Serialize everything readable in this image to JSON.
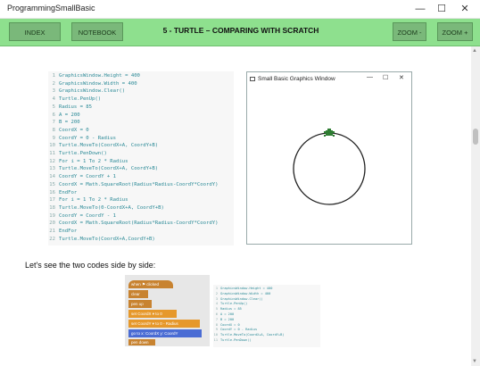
{
  "window": {
    "title": "ProgrammingSmallBasic",
    "minimize": "—",
    "maximize": "☐",
    "close": "✕"
  },
  "toolbar": {
    "index_label": "INDEX",
    "notebook_label": "NOTEBOOK",
    "page_title": "5 - TURTLE – COMPARING WITH SCRATCH",
    "zoom_out_label": "ZOOM -",
    "zoom_in_label": "ZOOM +"
  },
  "code": [
    {
      "n": "1",
      "t": "GraphicsWindow.Height = 400"
    },
    {
      "n": "2",
      "t": "GraphicsWindow.Width = 400"
    },
    {
      "n": "3",
      "t": "GraphicsWindow.Clear()"
    },
    {
      "n": "4",
      "t": "Turtle.PenUp()"
    },
    {
      "n": "5",
      "t": "Radius = 85"
    },
    {
      "n": "6",
      "t": "A = 200"
    },
    {
      "n": "7",
      "t": "B = 200"
    },
    {
      "n": "8",
      "t": "CoordX = 0"
    },
    {
      "n": "9",
      "t": "CoordY = 0 - Radius"
    },
    {
      "n": "10",
      "t": "Turtle.MoveTo(CoordX+A, CoordY+B)"
    },
    {
      "n": "11",
      "t": "Turtle.PenDown()"
    },
    {
      "n": "12",
      "t": "For i = 1 To 2 * Radius"
    },
    {
      "n": "13",
      "t": "  Turtle.MoveTo(CoordX+A, CoordY+B)"
    },
    {
      "n": "14",
      "t": "  CoordY = CoordY + 1"
    },
    {
      "n": "15",
      "t": "  CoordX = Math.SquareRoot(Radius*Radius-CoordY*CoordY)"
    },
    {
      "n": "16",
      "t": "EndFor"
    },
    {
      "n": "17",
      "t": "For i = 1 To 2 * Radius"
    },
    {
      "n": "18",
      "t": "  Turtle.MoveTo(0-CoordX+A, CoordY+B)"
    },
    {
      "n": "19",
      "t": "  CoordY = CoordY - 1"
    },
    {
      "n": "20",
      "t": "  CoordX = Math.SquareRoot(Radius*Radius-CoordY*CoordY)"
    },
    {
      "n": "21",
      "t": "EndFor"
    },
    {
      "n": "22",
      "t": "Turtle.MoveTo(CoordX+A,CoordY+B)"
    }
  ],
  "graphics_window": {
    "title": "Small Basic Graphics Window",
    "minimize": "—",
    "maximize": "☐",
    "close": "✕"
  },
  "paragraph": "Let's see the two codes side by side:",
  "scratch": {
    "when_clicked": "when ⚑ clicked",
    "clear": "clear",
    "pen_up": "pen up",
    "set_coordx": "set CoordX ▾ to 0",
    "set_coordy": "set CoordY ▾ to 0 - Radius",
    "go_to": "go to x: CoordX y: CoordY",
    "pen_down": "pen down"
  },
  "mini_code": [
    {
      "n": "1",
      "t": "GraphicsWindow.Height = 400"
    },
    {
      "n": "2",
      "t": "GraphicsWindow.Width = 400"
    },
    {
      "n": "3",
      "t": "GraphicsWindow.Clear()"
    },
    {
      "n": "4",
      "t": "Turtle.PenUp()"
    },
    {
      "n": "5",
      "t": "Radius = 85"
    },
    {
      "n": "6",
      "t": "A = 200"
    },
    {
      "n": "7",
      "t": "B = 200"
    },
    {
      "n": "8",
      "t": "CoordX = 0"
    },
    {
      "n": "9",
      "t": "CoordY = 0 - Radius"
    },
    {
      "n": "10",
      "t": "Turtle.MoveTo(CoordX+A, CoordY+B)"
    },
    {
      "n": "11",
      "t": "Turtle.PenDown()"
    }
  ],
  "colors": {
    "toolbar_bg": "#8ee08e",
    "button_bg": "#7ab87a",
    "code_text": "#2b8a97",
    "turtle": "#2e7d32"
  }
}
